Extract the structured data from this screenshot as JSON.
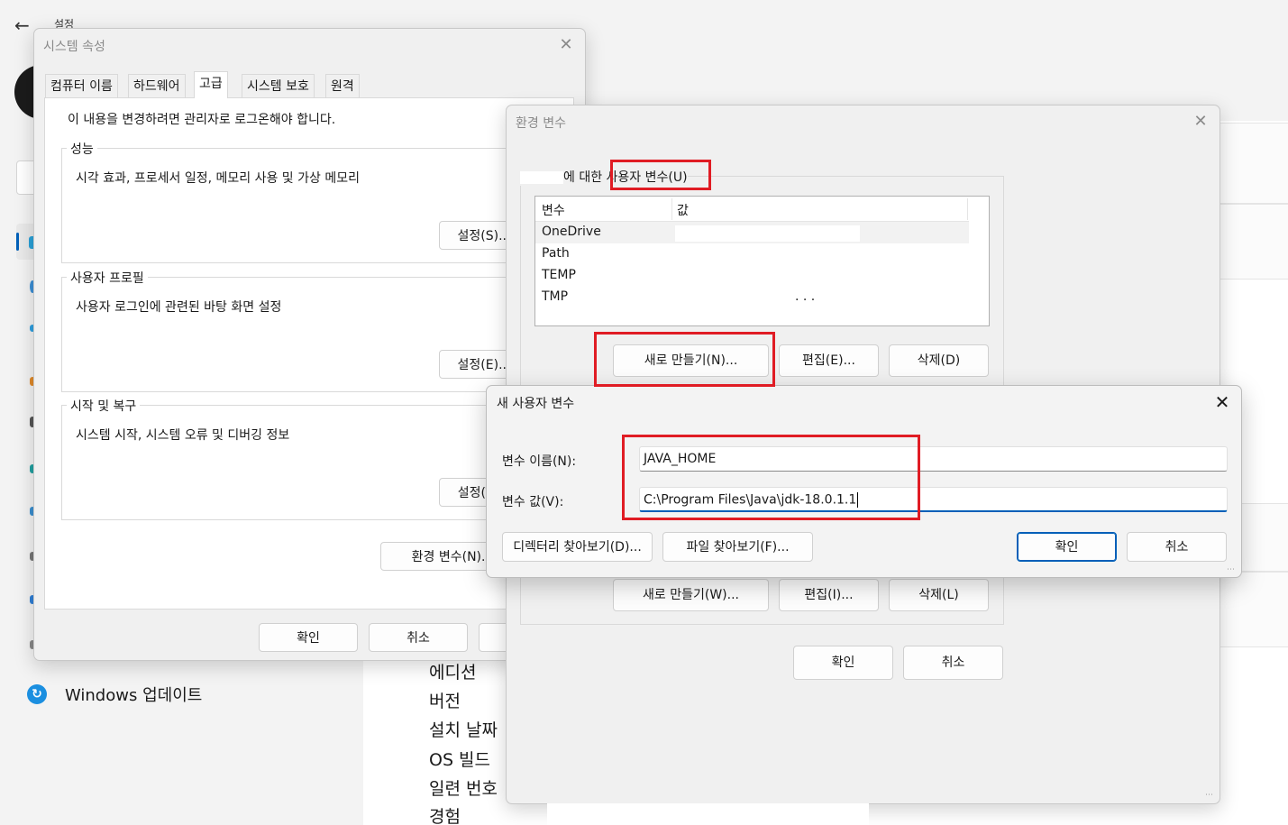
{
  "settings": {
    "title": "설정",
    "back_icon": "arrow-left-icon",
    "windows_update_label": "Windows 업데이트",
    "spec_labels": [
      "에디션",
      "버전",
      "설치 날짜",
      "OS 빌드",
      "일련 번호",
      "경험"
    ]
  },
  "system_properties": {
    "title": "시스템 속성",
    "tabs": [
      "컴퓨터 이름",
      "하드웨어",
      "고급",
      "시스템 보호",
      "원격"
    ],
    "active_tab": "고급",
    "admin_note": "이 내용을 변경하려면 관리자로 로그온해야 합니다.",
    "performance": {
      "title": "성능",
      "description": "시각 효과, 프로세서 일정, 메모리 사용 및 가상 메모리",
      "button": "설정(S)..."
    },
    "user_profiles": {
      "title": "사용자 프로필",
      "description": "사용자 로그인에 관련된 바탕 화면 설정",
      "button": "설정(E)..."
    },
    "startup_recovery": {
      "title": "시작 및 복구",
      "description": "시스템 시작, 시스템 오류 및 디버깅 정보",
      "button": "설정(T)..."
    },
    "env_button": "환경 변수(N)...",
    "ok": "확인",
    "cancel": "취소"
  },
  "environment_variables": {
    "title": "환경 변수",
    "user_section_prefix": "에 대한",
    "user_section_label": "사용자 변수(U)",
    "columns": [
      "변수",
      "값"
    ],
    "user_variables": [
      {
        "name": "OneDrive",
        "value": ""
      },
      {
        "name": "Path",
        "value": ""
      },
      {
        "name": "TEMP",
        "value": ""
      },
      {
        "name": "TMP",
        "value": ". .                          ."
      }
    ],
    "user_buttons": {
      "new": "새로 만들기(N)...",
      "edit": "편집(E)...",
      "delete": "삭제(D)"
    },
    "system_buttons": {
      "new": "새로 만들기(W)...",
      "edit": "편집(I)...",
      "delete": "삭제(L)"
    },
    "ok": "확인",
    "cancel": "취소"
  },
  "new_user_variable": {
    "title": "새 사용자 변수",
    "name_label": "변수 이름(N):",
    "name_value": "JAVA_HOME",
    "value_label": "변수 값(V):",
    "value_value": "C:\\Program Files\\Java\\jdk-18.0.1.1",
    "browse_directory": "디렉터리 찾아보기(D)...",
    "browse_file": "파일 찾아보기(F)...",
    "ok": "확인",
    "cancel": "취소"
  },
  "colors": {
    "highlight_box": "#e01c24",
    "accent": "#005fb8",
    "dialog_bg": "#f0f0f0"
  }
}
